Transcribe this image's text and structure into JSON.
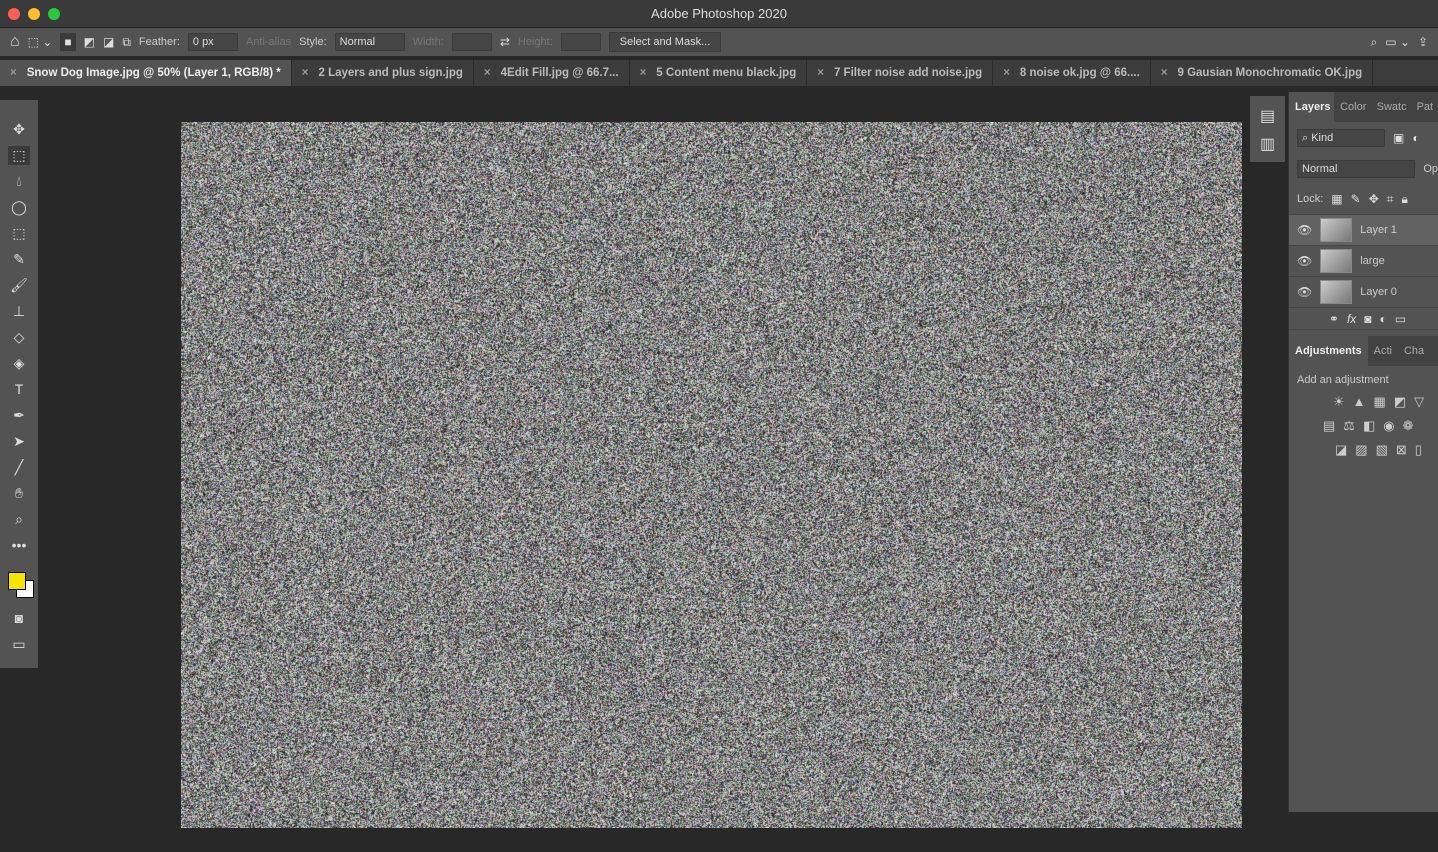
{
  "app": {
    "title": "Adobe Photoshop 2020"
  },
  "options": {
    "feather_label": "Feather:",
    "feather_value": "0 px",
    "antialias": "Anti-alias",
    "style_label": "Style:",
    "style_value": "Normal",
    "width_label": "Width:",
    "height_label": "Height:",
    "select_mask": "Select and Mask..."
  },
  "tabs": [
    {
      "label": "Snow Dog Image.jpg @ 50% (Layer 1, RGB/8) *"
    },
    {
      "label": "2 Layers and plus sign.jpg"
    },
    {
      "label": "4Edit Fill.jpg @ 66.7..."
    },
    {
      "label": "5 Content menu black.jpg"
    },
    {
      "label": "7 Filter noise add noise.jpg"
    },
    {
      "label": "8 noise ok.jpg @ 66...."
    },
    {
      "label": "9 Gausian Monochromatic OK.jpg"
    }
  ],
  "layers_panel": {
    "tabs": [
      "Layers",
      "Color",
      "Swatc",
      "Pat"
    ],
    "filter": "Kind",
    "blend": "Normal",
    "opacity_abbr": "Op",
    "lock_label": "Lock:",
    "layers": [
      {
        "name": "Layer 1",
        "selected": true
      },
      {
        "name": "large"
      },
      {
        "name": "Layer 0"
      }
    ]
  },
  "adjustments_panel": {
    "tabs": [
      "Adjustments",
      "Acti",
      "Cha"
    ],
    "hint": "Add an adjustment"
  },
  "colors": {
    "foreground": "#f5e400",
    "background": "#ffffff"
  }
}
